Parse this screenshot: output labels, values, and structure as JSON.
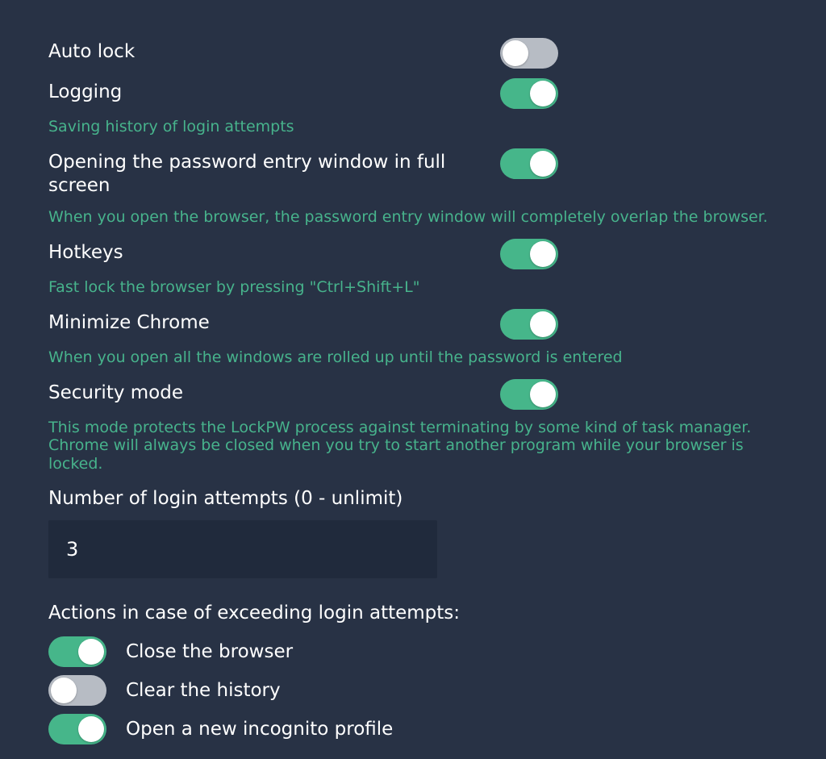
{
  "settings": {
    "auto_lock": {
      "title": "Auto lock",
      "on": false
    },
    "logging": {
      "title": "Logging",
      "on": true,
      "desc": "Saving history of login attempts"
    },
    "fullscreen": {
      "title": "Opening the password entry window in full screen",
      "on": true,
      "desc": "When you open the browser, the password entry window will completely overlap the browser."
    },
    "hotkeys": {
      "title": "Hotkeys",
      "on": true,
      "desc": "Fast lock the browser by pressing \"Ctrl+Shift+L\""
    },
    "minimize": {
      "title": "Minimize Chrome",
      "on": true,
      "desc": "When you open all the windows are rolled up until the password is entered"
    },
    "security": {
      "title": "Security mode",
      "on": true,
      "desc": "This mode protects the LockPW process against terminating by some kind of task manager. Chrome will always be closed when you try to start another program while your browser is locked."
    }
  },
  "attempts": {
    "label": "Number of login attempts (0 - unlimit)",
    "value": "3"
  },
  "actions": {
    "heading": "Actions in case of exceeding login attempts:",
    "close": {
      "label": "Close the browser",
      "on": true
    },
    "clear": {
      "label": "Clear the history",
      "on": false
    },
    "incognito": {
      "label": "Open a new incognito profile",
      "on": true
    }
  }
}
